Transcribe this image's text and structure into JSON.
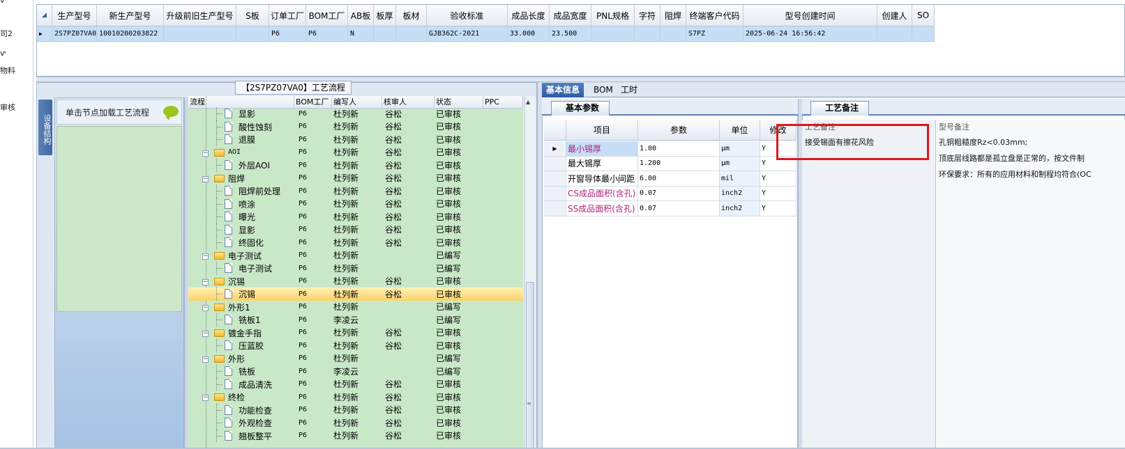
{
  "left_strip": {
    "items": [
      "ⱱ",
      "司2",
      "ⱱ",
      "物料",
      "审核"
    ]
  },
  "top_grid": {
    "headers": [
      "生产型号",
      "新生产型号",
      "升级前旧生产型号",
      "S板",
      "订单工厂",
      "BOM工厂",
      "AB板",
      "板厚",
      "板材",
      "验收标准",
      "成品长度",
      "成品宽度",
      "PNL规格",
      "字符",
      "阻焊",
      "终端客户代码",
      "型号创建时间",
      "创建人",
      "SO"
    ],
    "row": [
      "2S7PZ07VA0",
      "10010200203822",
      "",
      "",
      "P6",
      "P6",
      "N",
      "",
      "",
      "GJB362C-2021",
      "33.000",
      "23.500",
      "",
      "",
      "",
      "S7PZ",
      "2025-06-24 16:56:42",
      "",
      ""
    ]
  },
  "tree_panel": {
    "title": "【2S7PZ07VA0】工艺流程",
    "side_tab": "设备结构",
    "nav_hint": "单击节点加载工艺流程",
    "headers": [
      "流程",
      "BOM工厂",
      "编写人",
      "核审人",
      "状态",
      "PPC"
    ],
    "rows": [
      {
        "name": "显影",
        "level": 2,
        "bom": "P6",
        "writer": "杜列新",
        "reviewer": "谷松",
        "status": "已审核"
      },
      {
        "name": "酸性蚀刻",
        "level": 2,
        "bom": "P6",
        "writer": "杜列新",
        "reviewer": "谷松",
        "status": "已审核"
      },
      {
        "name": "退膜",
        "level": 2,
        "bom": "P6",
        "writer": "杜列新",
        "reviewer": "谷松",
        "status": "已审核"
      },
      {
        "name": "AOI",
        "level": 1,
        "bom": "P6",
        "writer": "杜列新",
        "reviewer": "谷松",
        "status": "已审核"
      },
      {
        "name": "外层AOI",
        "level": 2,
        "bom": "P6",
        "writer": "杜列新",
        "reviewer": "谷松",
        "status": "已审核"
      },
      {
        "name": "阻焊",
        "level": 1,
        "bom": "P6",
        "writer": "杜列新",
        "reviewer": "谷松",
        "status": "已审核"
      },
      {
        "name": "阻焊前处理",
        "level": 2,
        "bom": "P6",
        "writer": "杜列新",
        "reviewer": "谷松",
        "status": "已审核"
      },
      {
        "name": "喷涂",
        "level": 2,
        "bom": "P6",
        "writer": "杜列新",
        "reviewer": "谷松",
        "status": "已审核"
      },
      {
        "name": "曝光",
        "level": 2,
        "bom": "P6",
        "writer": "杜列新",
        "reviewer": "谷松",
        "status": "已审核"
      },
      {
        "name": "显影",
        "level": 2,
        "bom": "P6",
        "writer": "杜列新",
        "reviewer": "谷松",
        "status": "已审核"
      },
      {
        "name": "终固化",
        "level": 2,
        "bom": "P6",
        "writer": "杜列新",
        "reviewer": "谷松",
        "status": "已审核"
      },
      {
        "name": "电子测试",
        "level": 1,
        "bom": "P6",
        "writer": "杜列新",
        "reviewer": "",
        "status": "已编写"
      },
      {
        "name": "电子测试",
        "level": 2,
        "bom": "P6",
        "writer": "杜列新",
        "reviewer": "",
        "status": "已编写"
      },
      {
        "name": "沉锡",
        "level": 1,
        "bom": "P6",
        "writer": "杜列新",
        "reviewer": "谷松",
        "status": "已审核"
      },
      {
        "name": "沉锡",
        "level": 2,
        "bom": "P6",
        "writer": "杜列新",
        "reviewer": "谷松",
        "status": "已审核",
        "selected": true
      },
      {
        "name": "外形1",
        "level": 1,
        "bom": "P6",
        "writer": "杜列新",
        "reviewer": "",
        "status": "已编写"
      },
      {
        "name": "铣板1",
        "level": 2,
        "bom": "P6",
        "writer": "李凌云",
        "reviewer": "",
        "status": "已编写"
      },
      {
        "name": "镀金手指",
        "level": 1,
        "bom": "P6",
        "writer": "杜列新",
        "reviewer": "谷松",
        "status": "已审核"
      },
      {
        "name": "压蓝胶",
        "level": 2,
        "bom": "P6",
        "writer": "杜列新",
        "reviewer": "谷松",
        "status": "已审核"
      },
      {
        "name": "外形",
        "level": 1,
        "bom": "P6",
        "writer": "杜列新",
        "reviewer": "",
        "status": "已编写"
      },
      {
        "name": "铣板",
        "level": 2,
        "bom": "P6",
        "writer": "李凌云",
        "reviewer": "",
        "status": "已编写"
      },
      {
        "name": "成品清洗",
        "level": 2,
        "bom": "P6",
        "writer": "杜列新",
        "reviewer": "谷松",
        "status": "已审核"
      },
      {
        "name": "终检",
        "level": 1,
        "bom": "P6",
        "writer": "杜列新",
        "reviewer": "谷松",
        "status": "已审核"
      },
      {
        "name": "功能检查",
        "level": 2,
        "bom": "P6",
        "writer": "杜列新",
        "reviewer": "谷松",
        "status": "已审核"
      },
      {
        "name": "外观检查",
        "level": 2,
        "bom": "P6",
        "writer": "杜列新",
        "reviewer": "谷松",
        "status": "已审核"
      },
      {
        "name": "翘板整平",
        "level": 2,
        "bom": "P6",
        "writer": "杜列新",
        "reviewer": "谷松",
        "status": "已审核"
      }
    ]
  },
  "right_tabs": [
    "基本信息",
    "BOM",
    "工时"
  ],
  "basic_params": {
    "subtab": "基本参数",
    "headers": [
      "项目",
      "参数",
      "单位",
      "修改"
    ],
    "rows": [
      {
        "item": "最小锡厚",
        "value": "1.00",
        "unit": "μm",
        "modified": "Y",
        "highlight": true,
        "current": true
      },
      {
        "item": "最大锡厚",
        "value": "1.200",
        "unit": "μm",
        "modified": "Y",
        "highlight": false
      },
      {
        "item": "开窗导体最小间距",
        "value": "6.00",
        "unit": "mil",
        "modified": "Y",
        "highlight": false
      },
      {
        "item": "CS成品面积(含孔)",
        "value": "0.07",
        "unit": "inch2",
        "modified": "Y",
        "highlight": true
      },
      {
        "item": "SS成品面积(含孔)",
        "value": "0.07",
        "unit": "inch2",
        "modified": "Y",
        "highlight": true
      }
    ]
  },
  "remarks": {
    "tab": "工艺备注",
    "col1_header": "工艺备注",
    "col2_header": "型号备注",
    "process_remark": "接受锡面有擦花风险",
    "model_remarks": [
      "孔铜粗糙度Rz<0.03mm;",
      "顶底层线路都是孤立盘是正常的，按文件制",
      "环保要求：所有的应用材料和制程均符合(OC"
    ]
  },
  "colors": {
    "accent_blue": "#2e5d9f",
    "tree_green": "#c9e8c8",
    "selected_row": "#f9d26b",
    "pink_text": "#b0247a",
    "highlight_cell": "#c6dff7",
    "red_box": "#e0171b"
  }
}
